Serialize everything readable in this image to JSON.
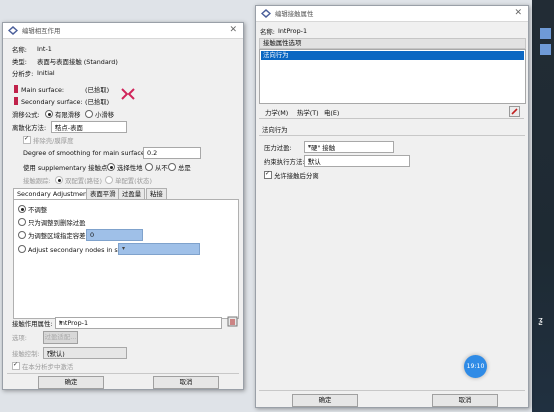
{
  "left_dialog": {
    "title": "编辑相互作用",
    "name_label": "名称:",
    "name_value": "Int-1",
    "type_label": "类型:",
    "type_value": "表面与表面接触 (Standard)",
    "step_label": "分析步:",
    "step_value": "Initial",
    "main_surface_label": "Main surface:",
    "main_surface_value": "(已拾取)",
    "secondary_surface_label": "Secondary surface:",
    "secondary_surface_value": "(已拾取)",
    "sliding_label": "滑移公式:",
    "sliding_options": [
      "有限滑移",
      "小滑移"
    ],
    "discretization_label": "离散化方法:",
    "discretization_value": "结点-表面",
    "exclude_shell_label": "排除壳/膜厚度",
    "smoothing_label": "Degree of smoothing for main surface:",
    "smoothing_value": "0.2",
    "supplementary_label": "使用 supplementary 接触点:",
    "supplementary_options": [
      "选择性地",
      "从不",
      "总是"
    ],
    "tracking_label": "接触跟踪:",
    "tracking_options": [
      "双配置(路径)",
      "单配置(状态)"
    ],
    "tabs": [
      "Secondary Adjustment",
      "表面平滑",
      "过盈量",
      "粘接"
    ],
    "adjust_options": [
      "不调整",
      "只为调整到删除过盈",
      "为调整区域指定容差:",
      "Adjust secondary nodes in set:"
    ],
    "tolerance_value": "0",
    "contact_property_label": "接触作用属性:",
    "contact_property_value": "IntProp-1",
    "options_label": "选项:",
    "interference_button": "过盈适配...",
    "contact_control_label": "接触控制:",
    "contact_control_value": "(默认)",
    "active_in_step_label": "在本分析步中激活",
    "ok_button": "确定",
    "cancel_button": "取消"
  },
  "right_dialog": {
    "title": "编辑接触属性",
    "name_label": "名称:",
    "name_value": "IntProp-1",
    "options_header": "接触属性选项",
    "options_list": [
      "法向行为"
    ],
    "menu": [
      "力学(M)",
      "热学(T)",
      "电(E)"
    ],
    "section_title": "法向行为",
    "pressure_label": "压力过盈:",
    "pressure_value": "\"硬\" 接触",
    "enforcement_label": "约束执行方法:",
    "enforcement_value": "默认",
    "allow_separation_label": "允许接触后分离",
    "ok_button": "确定",
    "cancel_button": "取消"
  },
  "overlay": {
    "time_badge": "19:10"
  }
}
